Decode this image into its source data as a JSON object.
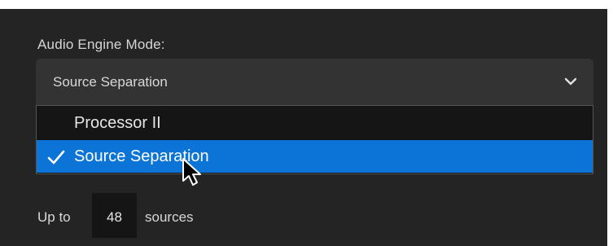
{
  "audio_engine": {
    "label": "Audio Engine Mode:",
    "selected": "Source Separation",
    "options": [
      {
        "label": "Processor II",
        "selected": false
      },
      {
        "label": "Source Separation",
        "selected": true
      }
    ]
  },
  "sources": {
    "prefix": "Up to",
    "count": "48",
    "suffix": "sources"
  },
  "colors": {
    "background": "#242424",
    "highlight": "#0b74d6"
  },
  "icons": {
    "chevron": "chevron-down-icon",
    "check": "checkmark-icon",
    "cursor": "mouse-pointer-icon"
  }
}
